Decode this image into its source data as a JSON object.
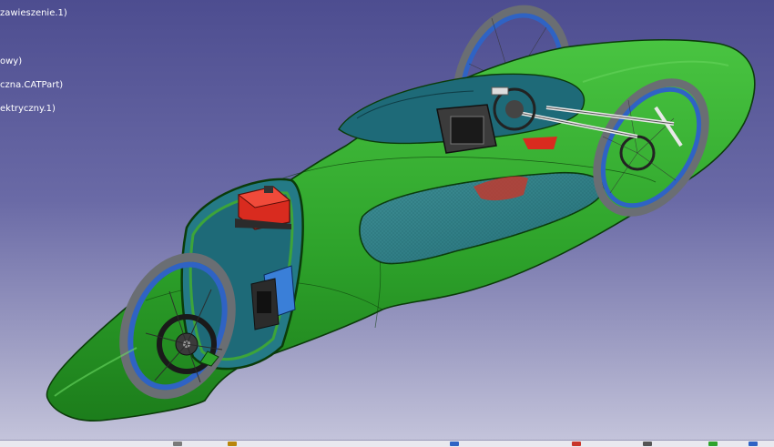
{
  "window": {
    "background_top": "#4d4d90",
    "background_bottom": "#c6c6dc"
  },
  "spec_tree": {
    "items": [
      {
        "label": "zawieszenie.1)"
      },
      {
        "label": "owy)"
      },
      {
        "label": "czna.CATPart)"
      },
      {
        "label": "ektryczny.1)"
      }
    ]
  },
  "model": {
    "body_color": "#2ea32b",
    "body_edge_color": "#0b3b0a",
    "cockpit_color": "#1e6a78",
    "wheel_rim_color": "#2f63c4",
    "tire_color": "#676b70",
    "component_red": "#d92b1f",
    "component_blue": "#3a7fd8"
  },
  "toolbar": {
    "icons": [
      "sketch-icon",
      "part-icon",
      "measure-icon",
      "axis-icon",
      "catalog-icon",
      "render-icon",
      "analysis-icon"
    ]
  }
}
